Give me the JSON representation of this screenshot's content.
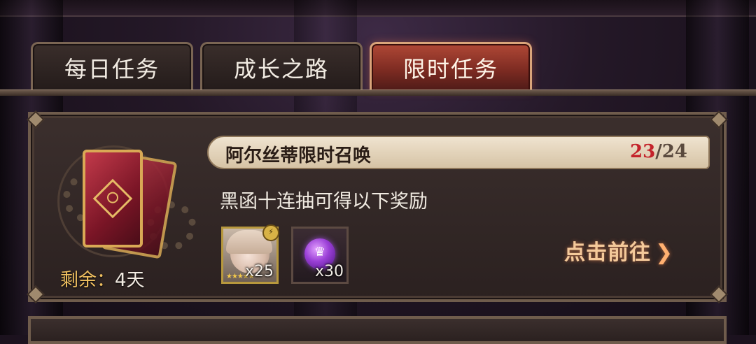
{
  "tabs": [
    {
      "label": "每日任务",
      "active": false
    },
    {
      "label": "成长之路",
      "active": false
    },
    {
      "label": "限时任务",
      "active": true
    }
  ],
  "task": {
    "title": "阿尔丝蒂限时召唤",
    "progress_current": "23",
    "progress_separator": "/",
    "progress_total": "24",
    "description": "黑函十连抽可得以下奖励",
    "remaining_label": "剩余：",
    "remaining_value": "4天",
    "goto_label": "点击前往",
    "goto_chevron": "❯",
    "rewards": [
      {
        "icon": "hero-portrait-icon",
        "quantity": "x25",
        "stars": "★★★★★"
      },
      {
        "icon": "purple-gem-icon",
        "quantity": "x30"
      }
    ]
  },
  "colors": {
    "active_tab": "#b04836",
    "progress_current": "#c4222a",
    "goto_text": "#f4c99a",
    "remaining_label": "#f0c060"
  }
}
